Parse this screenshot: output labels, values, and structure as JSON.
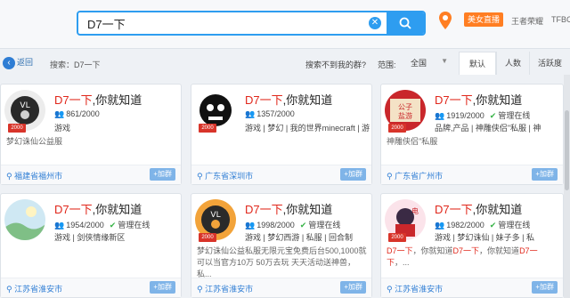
{
  "search": {
    "value": "D7一下"
  },
  "topbar": {
    "live_badge": "美女直播",
    "link1": "王者荣耀",
    "link2": "TFBC"
  },
  "filter": {
    "back_label": "返回",
    "summary": "搜索：D7一下",
    "not_found": "搜索不到我的群?",
    "scope_label": "范围:",
    "scope_value": "全国",
    "tabs": [
      "默认",
      "人数",
      "活跃度"
    ]
  },
  "cards": [
    {
      "title_hl": "D7一下",
      "title_rest": ",你就知道",
      "count": "861/2000",
      "manager": "",
      "tags": "游戏",
      "desc": "梦幻诛仙公益服",
      "location": "福建省福州市",
      "join": "+加群",
      "level": "2000"
    },
    {
      "title_hl": "D7一下",
      "title_rest": ",你就知道",
      "count": "1357/2000",
      "manager": "",
      "tags": "游戏 | 梦幻 | 我的世界minecraft | 游",
      "desc": "",
      "location": "广东省深圳市",
      "join": "+加群",
      "level": "2000"
    },
    {
      "title_hl": "D7一下",
      "title_rest": ",你就知道",
      "count": "1919/2000",
      "manager": "管理在线",
      "tags": "品牌,产品 | 神雕侠侣\"私服 | 神",
      "desc": "神雕侠侣\"私服",
      "location": "广东省广州市",
      "join": "+加群",
      "level": "2000"
    },
    {
      "title_hl": "D7一下",
      "title_rest": ",你就知道",
      "count": "1954/2000",
      "manager": "管理在线",
      "tags": "游戏 | 剑侠情缘新区",
      "desc": "",
      "location": "江苏省淮安市",
      "join": "+加群",
      "level": ""
    },
    {
      "title_hl": "D7一下",
      "title_rest": ",你就知道",
      "count": "1998/2000",
      "manager": "管理在线",
      "tags": "游戏 | 梦幻西游 | 私服 | 回合制",
      "desc": "梦幻诛仙公益私服无限元宝免费后台500,1000就可以当官方10万 50万去玩 天天活动送神兽，私...",
      "location": "江苏省淮安市",
      "join": "+加群",
      "level": "2000"
    },
    {
      "title_hl": "D7一下",
      "title_rest": ",你就知道",
      "count": "1982/2000",
      "manager": "管理在线",
      "tags": "游戏 | 梦幻诛仙 | 妹子多 | 私",
      "desc_parts": [
        "D7一下",
        "，你就知道",
        "D7一下",
        "，你就知道",
        "D7一下",
        "，..."
      ],
      "location": "江苏省淮安市",
      "join": "+加群",
      "level": "2000"
    }
  ],
  "colors": {
    "accent": "#2e9df0",
    "highlight": "#e0271b",
    "location": "#2e7dd4",
    "live": "#ff7e22"
  }
}
